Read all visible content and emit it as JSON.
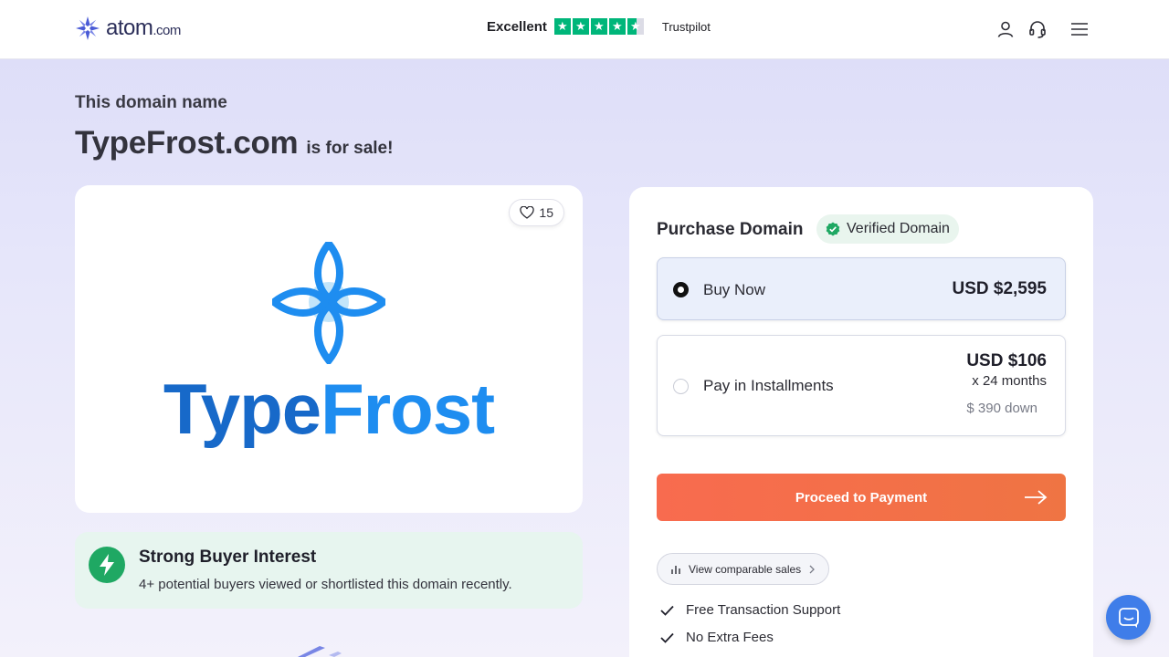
{
  "header": {
    "logo": {
      "word": "atom",
      "suffix": ".com"
    },
    "trustpilot": {
      "rating_label": "Excellent",
      "brand": "Trustpilot",
      "stars": 4.5
    },
    "icons": [
      "user-icon",
      "headset-icon",
      "menu-icon"
    ]
  },
  "hero": {
    "eyebrow": "This domain name",
    "domain": "TypeFrost.com",
    "suffix": "is for sale!"
  },
  "logo_card": {
    "likes": "15",
    "brand_part1": "Type",
    "brand_part2": "Frost"
  },
  "interest": {
    "title": "Strong Buyer Interest",
    "subtitle": "4+ potential buyers viewed or shortlisted this domain recently."
  },
  "purchase": {
    "title": "Purchase Domain",
    "verified": "Verified Domain",
    "options": [
      {
        "label": "Buy Now",
        "price": "USD $2,595",
        "selected": true
      },
      {
        "label": "Pay in Installments",
        "price": "USD $106",
        "months": "x 24 months",
        "down": "$ 390 down",
        "selected": false
      }
    ],
    "proceed": "Proceed to Payment",
    "comparable": "View comparable sales",
    "features": [
      "Free Transaction Support",
      "No Extra Fees"
    ]
  },
  "colors": {
    "accent": "#f86b4f",
    "brand_blue": "#1e8df0",
    "success": "#1fa863",
    "trustpilot": "#00b67a",
    "chat": "#3f7de9"
  }
}
